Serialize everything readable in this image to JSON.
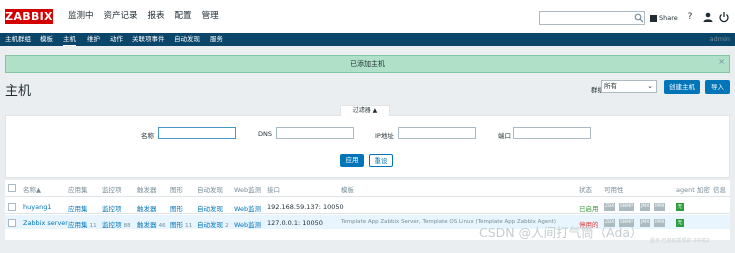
{
  "header": {
    "logo": "ZABBIX",
    "menu": [
      "监测中",
      "资产记录",
      "报表",
      "配置",
      "管理"
    ],
    "active_menu": "配置",
    "share_label": "Share",
    "help_icon": "?"
  },
  "subnav": {
    "items": [
      "主机群组",
      "模板",
      "主机",
      "维护",
      "动作",
      "关联项事件",
      "自动发现",
      "服务"
    ],
    "active": "主机",
    "user": "admin"
  },
  "message": {
    "text": "已添加主机",
    "close": "×"
  },
  "page": {
    "title": "主机",
    "group_label": "群组",
    "group_value": "所有",
    "create_button": "创建主机",
    "import_button": "导入"
  },
  "filter": {
    "tab_label": "过滤器 ▲",
    "name_label": "名称",
    "dns_label": "DNS",
    "ip_label": "IP地址",
    "port_label": "端口",
    "apply_button": "应用",
    "reset_button": "重设"
  },
  "table": {
    "headers": [
      "名称▲",
      "应用集",
      "监控项",
      "触发器",
      "图形",
      "自动发现",
      "Web监测",
      "接口",
      "模板",
      "状态",
      "可用性",
      "agent 加密",
      "信息"
    ],
    "rows": [
      {
        "name": "huyang1",
        "apps": "应用集",
        "apps_count": "",
        "items": "监控项",
        "items_count": "",
        "triggers": "触发器",
        "triggers_count": "",
        "graphs": "图形",
        "graphs_count": "",
        "discovery": "自动发现",
        "discovery_count": "",
        "web": "Web监测",
        "interface": "192.168.59.137: 10050",
        "templates": "",
        "status": "已启用",
        "availability": [
          "ZBX",
          "SNMP",
          "JMX",
          "IPMI"
        ],
        "encryption": "无"
      },
      {
        "name": "Zabbix server",
        "apps": "应用集",
        "apps_count": "11",
        "items": "监控项",
        "items_count": "88",
        "triggers": "触发器",
        "triggers_count": "46",
        "graphs": "图形",
        "graphs_count": "11",
        "discovery": "自动发现",
        "discovery_count": "2",
        "web": "Web监测",
        "interface": "127.0.0.1: 10050",
        "templates": "Template App Zabbix Server, Template OS Linux (Template App Zabbix Agent)",
        "status": "停用的",
        "availability": [
          "ZBX",
          "SNMP",
          "JMX",
          "IPMI"
        ],
        "encryption": "无"
      }
    ]
  },
  "footer": {
    "shown": "显示 已自动发现的 2中的2"
  },
  "watermark": "CSDN @人间打气筒（Ada）",
  "colors": {
    "brand": "#d40000",
    "nav": "#0a466a",
    "accent": "#0275b8",
    "success_bg": "#b0e0c8",
    "enabled": "#3a9a3a",
    "disabled": "#e33734"
  }
}
